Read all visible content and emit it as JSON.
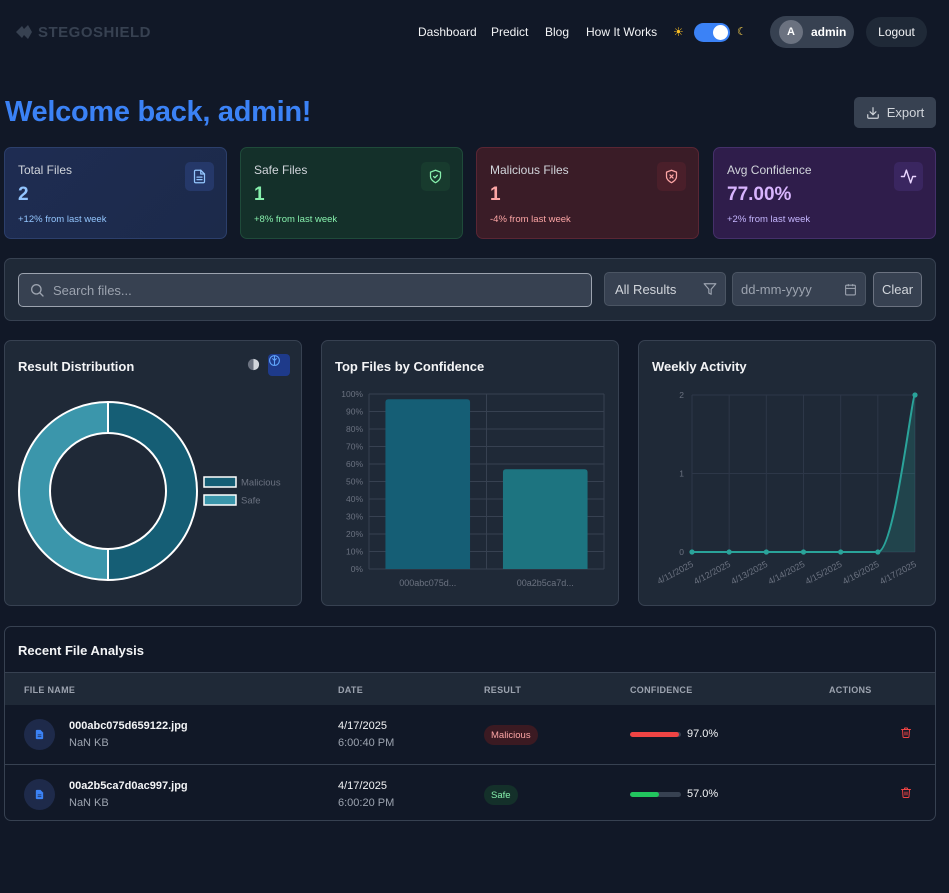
{
  "brand": {
    "name": "STEGOSHIELD"
  },
  "nav": {
    "links": [
      "Dashboard",
      "Predict",
      "Blog",
      "How It Works"
    ],
    "theme_toggle": {
      "state": "dark"
    },
    "user": {
      "initial": "A",
      "name": "admin"
    },
    "logout_label": "Logout"
  },
  "header": {
    "welcome": "Welcome back, admin!",
    "export_label": "Export"
  },
  "stats": [
    {
      "label": "Total Files",
      "value": "2",
      "delta": "+12% from last week",
      "icon": "file-icon"
    },
    {
      "label": "Safe Files",
      "value": "1",
      "delta": "+8% from last week",
      "icon": "shield-check-icon"
    },
    {
      "label": "Malicious Files",
      "value": "1",
      "delta": "-4% from last week",
      "icon": "shield-x-icon"
    },
    {
      "label": "Avg Confidence",
      "value": "77.00%",
      "delta": "+2% from last week",
      "icon": "activity-icon"
    }
  ],
  "filters": {
    "search_placeholder": "Search files...",
    "result_select": "All Results",
    "date_placeholder": "dd-mm-yyyy",
    "clear_label": "Clear"
  },
  "panels": {
    "distribution_title": "Result Distribution",
    "confidence_title": "Top Files by Confidence",
    "weekly_title": "Weekly Activity"
  },
  "chart_data": [
    {
      "type": "pie",
      "title": "Result Distribution",
      "categories": [
        "Malicious",
        "Safe"
      ],
      "values": [
        1,
        1
      ],
      "colors": [
        "#155e75",
        "#3b96ab"
      ],
      "legend": "right"
    },
    {
      "type": "bar",
      "title": "Top Files by Confidence",
      "categories": [
        "000abc075d...",
        "00a2b5ca7d..."
      ],
      "values": [
        97,
        57
      ],
      "ylim": [
        0,
        100
      ],
      "yticks": [
        "0%",
        "10%",
        "20%",
        "30%",
        "40%",
        "50%",
        "60%",
        "70%",
        "80%",
        "90%",
        "100%"
      ],
      "colors": [
        "#155e75",
        "#1d7480"
      ],
      "grid": true
    },
    {
      "type": "area",
      "title": "Weekly Activity",
      "categories": [
        "4/11/2025",
        "4/12/2025",
        "4/13/2025",
        "4/14/2025",
        "4/15/2025",
        "4/16/2025",
        "4/17/2025"
      ],
      "values": [
        0,
        0,
        0,
        0,
        0,
        0,
        2
      ],
      "ylim": [
        0,
        2
      ],
      "yticks": [
        "0",
        "1",
        "2"
      ],
      "color": "#2aa39a",
      "grid": true
    }
  ],
  "table": {
    "title": "Recent File Analysis",
    "columns": [
      "FILE NAME",
      "DATE",
      "RESULT",
      "CONFIDENCE",
      "ACTIONS"
    ],
    "rows": [
      {
        "name": "000abc075d659122.jpg",
        "size": "NaN KB",
        "date": "4/17/2025",
        "time": "6:00:40 PM",
        "result": "Malicious",
        "confidence": 97.0,
        "confidence_label": "97.0%",
        "bar_color": "#ef4444"
      },
      {
        "name": "00a2b5ca7d0ac997.jpg",
        "size": "NaN KB",
        "date": "4/17/2025",
        "time": "6:00:20 PM",
        "result": "Safe",
        "confidence": 57.0,
        "confidence_label": "57.0%",
        "bar_color": "#22c55e"
      }
    ]
  },
  "colors": {
    "accent": "#3b82f6",
    "background": "#111827",
    "panel": "#1f2937"
  }
}
